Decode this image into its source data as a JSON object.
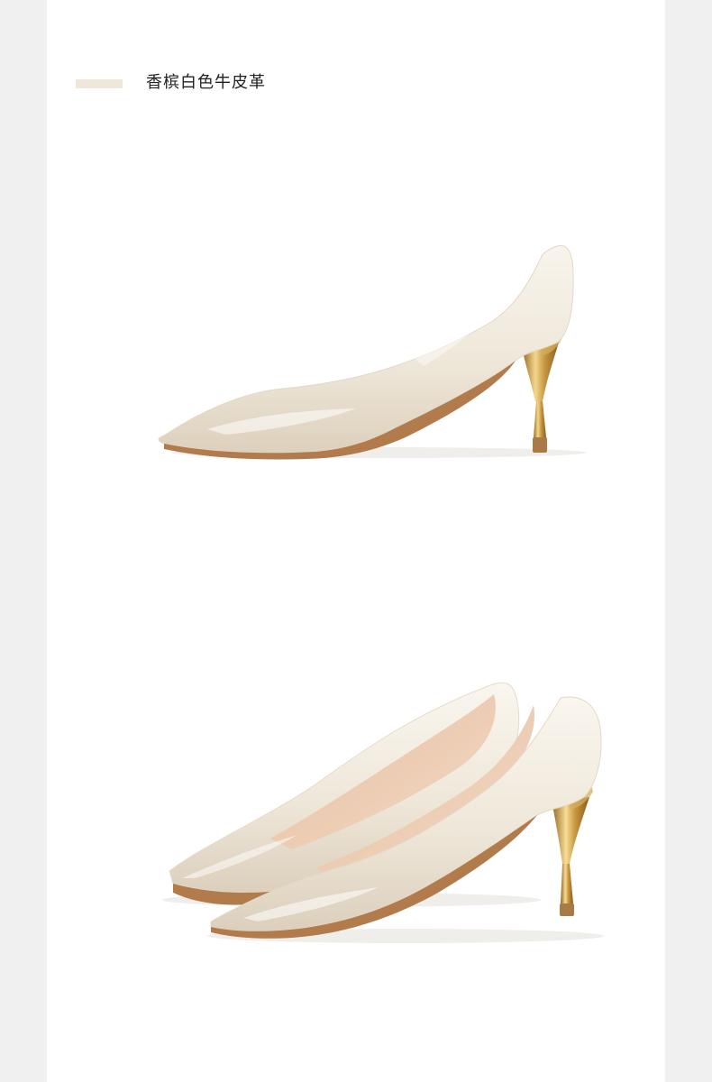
{
  "product": {
    "color_title": "香槟白色牛皮革",
    "swatch_color": "#efe8da",
    "leather_color": "#efe8da",
    "lining_color": "#e7c5aa",
    "heel_metal": "gold",
    "views": [
      {
        "name": "side-profile",
        "icon": "pump-shoe-side-icon"
      },
      {
        "name": "pair-angle",
        "icon": "pump-shoe-pair-icon"
      }
    ]
  }
}
